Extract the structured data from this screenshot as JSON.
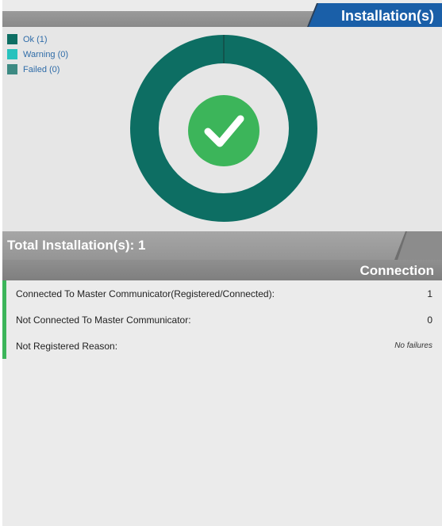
{
  "header": {
    "title": "Installation(s)",
    "tab_color": "#1a5fa8"
  },
  "legend": {
    "items": [
      {
        "label": "Ok (1)",
        "color": "#0d6e63",
        "icon": "ok-swatch"
      },
      {
        "label": "Warning (0)",
        "color": "#26c2bd",
        "icon": "warning-swatch"
      },
      {
        "label": "Failed (0)",
        "color": "#3d8a83",
        "icon": "failed-swatch"
      }
    ]
  },
  "donut": {
    "ok": 1,
    "warning": 0,
    "failed": 0,
    "ring_color": "#0d6e63",
    "center_icon": "checkmark-icon",
    "center_color": "#3cb55a"
  },
  "total": {
    "label": "Total Installation(s): 1"
  },
  "connection": {
    "title": "Connection",
    "accent_color": "#3cb55a",
    "rows": [
      {
        "label": "Connected To Master Communicator(Registered/Connected):",
        "value": "1"
      },
      {
        "label": "Not Connected To Master Communicator:",
        "value": "0"
      },
      {
        "label": "Not Registered Reason:",
        "value": "No failures"
      }
    ]
  }
}
